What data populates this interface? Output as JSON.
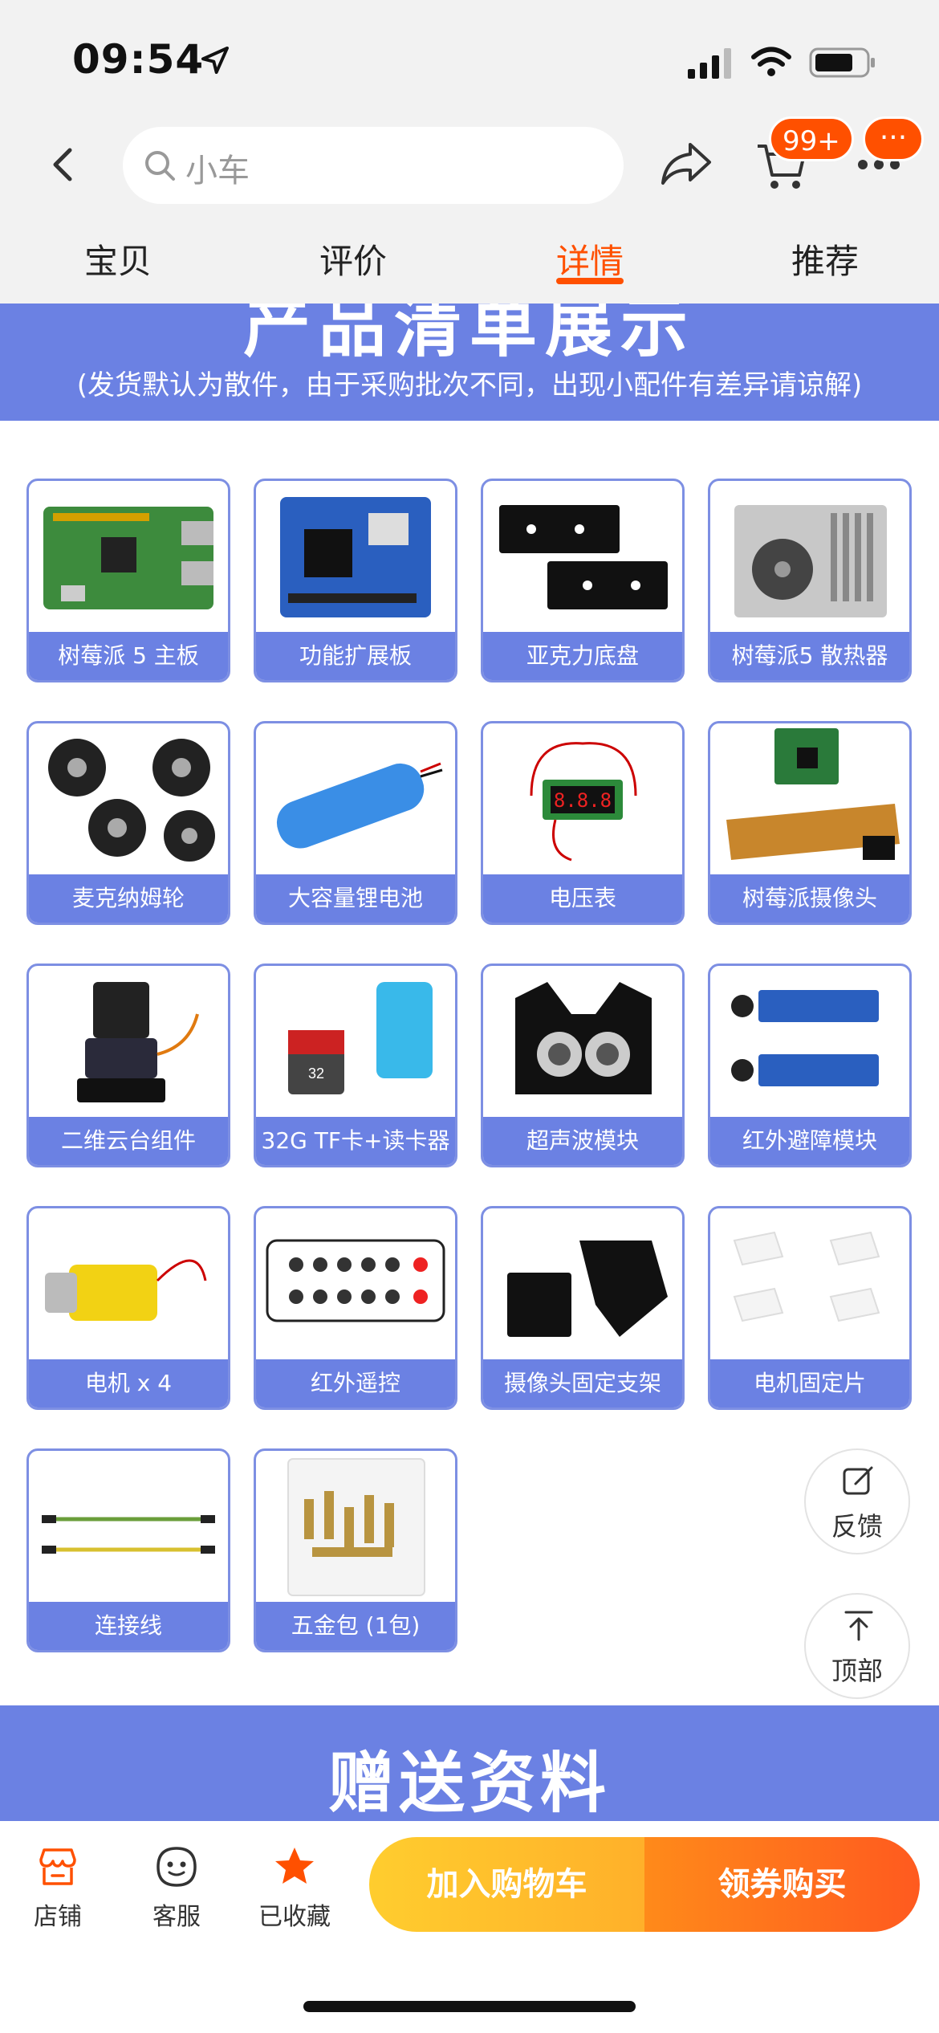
{
  "status_bar": {
    "time": "09:54"
  },
  "nav": {
    "search_placeholder": "小车",
    "cart_badge": "99+",
    "more_badge": "···"
  },
  "tabs": [
    {
      "label": "宝贝"
    },
    {
      "label": "评价"
    },
    {
      "label": "详情",
      "active": true
    },
    {
      "label": "推荐"
    }
  ],
  "banner": {
    "title": "产品清单展示",
    "subtitle": "(发货默认为散件，由于采购批次不同，出现小配件有差异请谅解)"
  },
  "products": [
    {
      "label": "树莓派 5 主板",
      "icon": "raspberry-pi-board"
    },
    {
      "label": "功能扩展板",
      "icon": "expansion-board"
    },
    {
      "label": "亚克力底盘",
      "icon": "acrylic-chassis"
    },
    {
      "label": "树莓派5 散热器",
      "icon": "cooler-fan"
    },
    {
      "label": "麦克纳姆轮",
      "icon": "mecanum-wheel"
    },
    {
      "label": "大容量锂电池",
      "icon": "lithium-battery"
    },
    {
      "label": "电压表",
      "icon": "voltmeter"
    },
    {
      "label": "树莓派摄像头",
      "icon": "camera-module"
    },
    {
      "label": "二维云台组件",
      "icon": "pan-tilt"
    },
    {
      "label": "32G TF卡+读卡器",
      "icon": "tf-card"
    },
    {
      "label": "超声波模块",
      "icon": "ultrasonic"
    },
    {
      "label": "红外避障模块",
      "icon": "ir-sensor"
    },
    {
      "label": "电机 x 4",
      "icon": "motor"
    },
    {
      "label": "红外遥控",
      "icon": "ir-remote"
    },
    {
      "label": "摄像头固定支架",
      "icon": "camera-bracket"
    },
    {
      "label": "电机固定片",
      "icon": "motor-mount"
    },
    {
      "label": "连接线",
      "icon": "cable"
    },
    {
      "label": "五金包 (1包)",
      "icon": "hardware-kit"
    }
  ],
  "float_buttons": {
    "feedback": "反馈",
    "top": "顶部"
  },
  "gift_banner": {
    "title": "赠送资料"
  },
  "bottom_bar": {
    "shop": "店铺",
    "service": "客服",
    "favorite": "已收藏",
    "add_to_cart": "加入购物车",
    "buy_with_coupon": "领券购买"
  },
  "colors": {
    "accent": "#ff5000",
    "banner": "#6b81e3",
    "card_border": "#7d8fe3"
  }
}
